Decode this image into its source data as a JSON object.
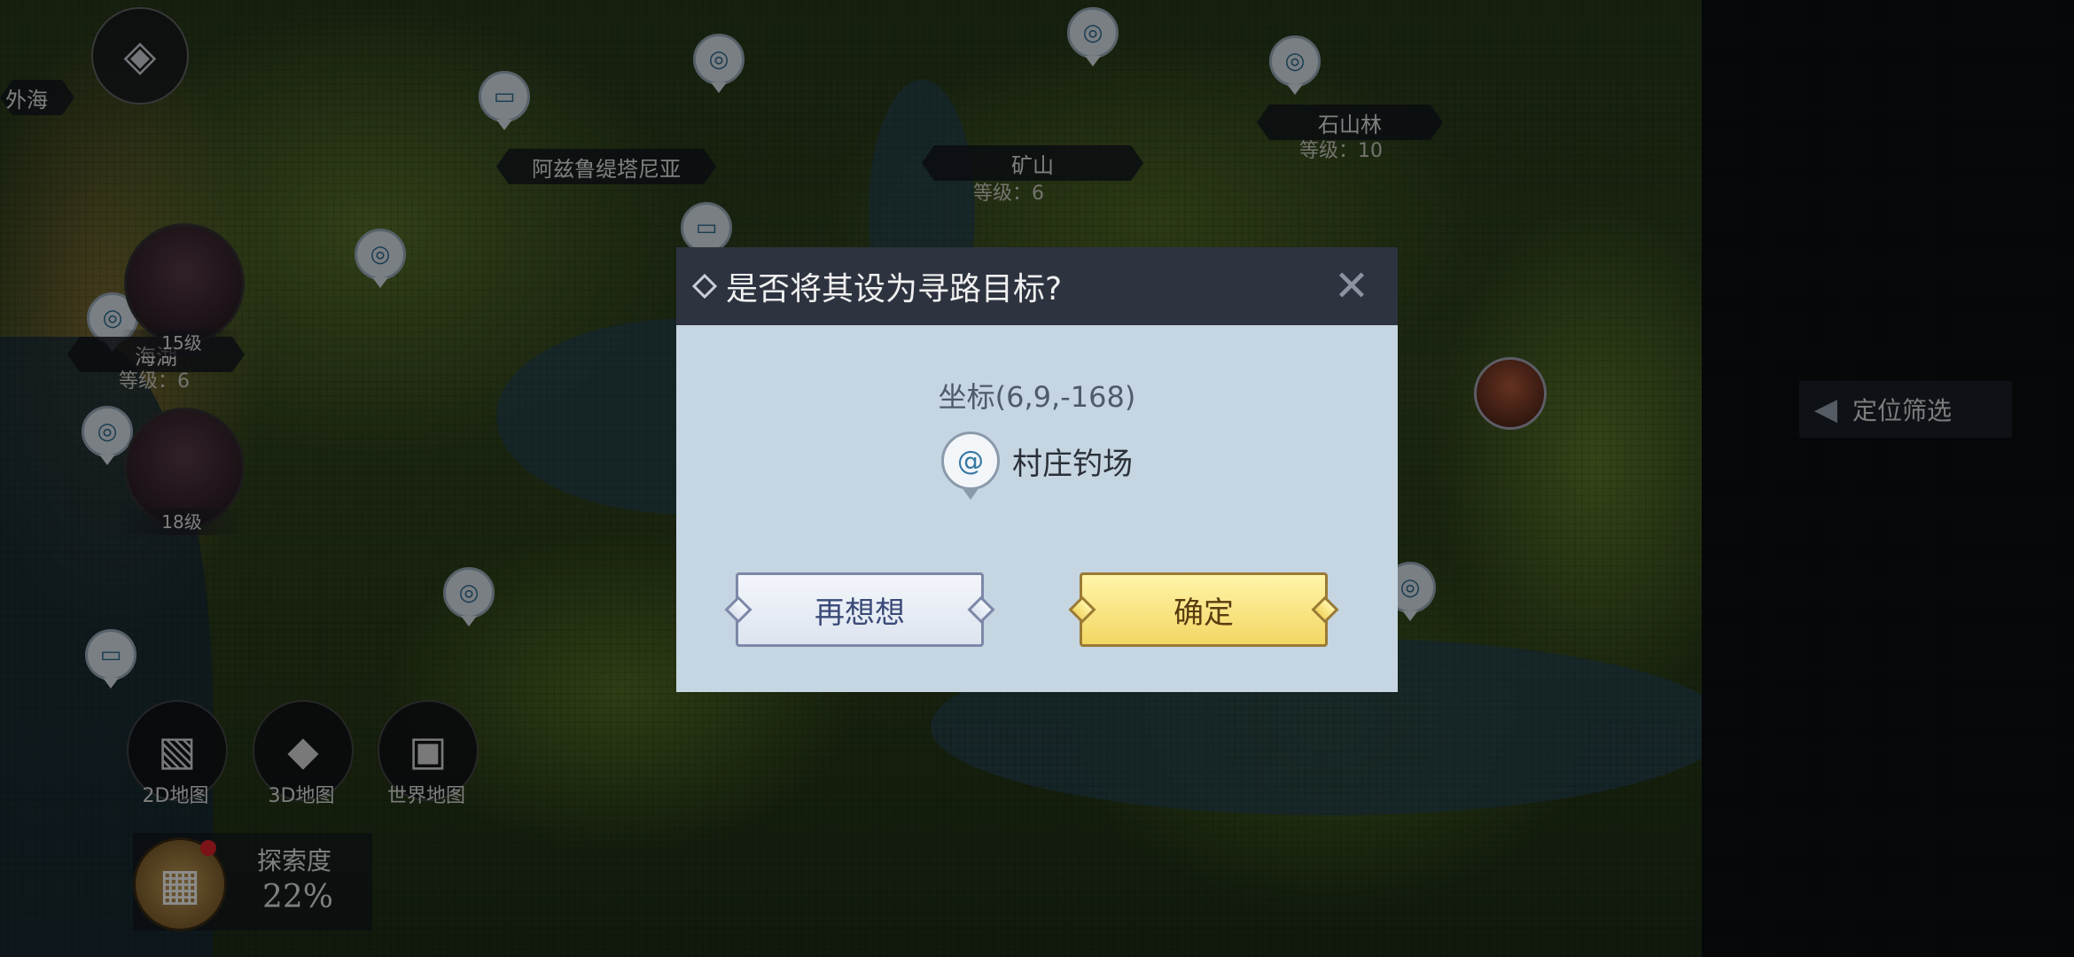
{
  "map": {
    "top_left_label": "外海",
    "labels": [
      {
        "name": "阿兹鲁缇塔尼亚",
        "level": ""
      },
      {
        "name": "矿山",
        "level": "等级：6"
      },
      {
        "name": "石山林",
        "level": "等级：10"
      },
      {
        "name": "海湖",
        "level": "等级：6"
      }
    ],
    "bosses": [
      {
        "level": "15级"
      },
      {
        "level": "18级"
      }
    ]
  },
  "map_buttons": [
    {
      "label": "2D地图",
      "icon": "map-2d-icon"
    },
    {
      "label": "3D地图",
      "icon": "map-3d-icon"
    },
    {
      "label": "世界地图",
      "icon": "world-map-icon"
    }
  ],
  "exploration": {
    "label": "探索度",
    "value": "22%"
  },
  "filter": {
    "label": "定位筛选"
  },
  "dialog": {
    "title": "是否将其设为寻路目标?",
    "coordinates": "坐标(6,9,-168)",
    "target_name": "村庄钓场",
    "target_icon": "fishing-spot-icon",
    "cancel_label": "再想想",
    "confirm_label": "确定"
  },
  "colors": {
    "dialog_header": "#2e3340",
    "dialog_body": "#c5d5e1",
    "confirm_button": "#f3d764",
    "cancel_button": "#e7ecf4"
  }
}
